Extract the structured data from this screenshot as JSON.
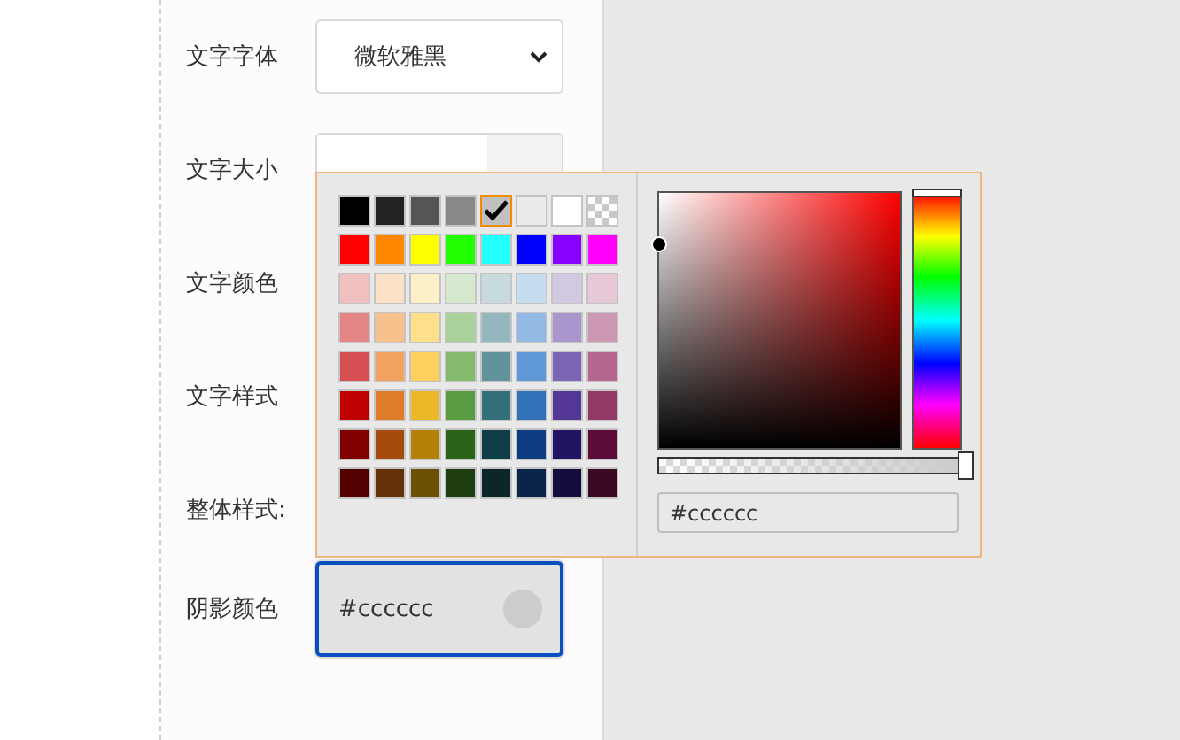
{
  "fields": [
    {
      "kind": "select",
      "label": "文字字体",
      "value": "微软雅黑"
    },
    {
      "kind": "unit",
      "label": "文字大小"
    },
    {
      "kind": "label",
      "label": "文字颜色"
    },
    {
      "kind": "label",
      "label": "文字样式"
    },
    {
      "kind": "label",
      "label": "整体样式:"
    },
    {
      "kind": "color",
      "label": "阴影颜色",
      "value": "#cccccc",
      "color": "#cccccc",
      "focused": true
    }
  ],
  "color_popup": {
    "swatches": [
      {
        "kind": "solid",
        "color": "#000000",
        "selected": false
      },
      {
        "kind": "solid",
        "color": "#222222",
        "selected": false
      },
      {
        "kind": "solid",
        "color": "#555555",
        "selected": false
      },
      {
        "kind": "solid",
        "color": "#888888",
        "selected": false
      },
      {
        "kind": "solid",
        "color": "#c0c0c0",
        "selected": true
      },
      {
        "kind": "solid",
        "color": "#ebebeb",
        "selected": false
      },
      {
        "kind": "solid",
        "color": "#ffffff",
        "selected": false
      },
      {
        "kind": "transparent",
        "selected": false
      },
      {
        "kind": "solid",
        "color": "#ff0000",
        "selected": false
      },
      {
        "kind": "solid",
        "color": "#ff8800",
        "selected": false
      },
      {
        "kind": "solid",
        "color": "#ffff00",
        "selected": false
      },
      {
        "kind": "solid",
        "color": "#22ff00",
        "selected": false
      },
      {
        "kind": "solid",
        "color": "#22ffff",
        "selected": false
      },
      {
        "kind": "solid",
        "color": "#0000ff",
        "selected": false
      },
      {
        "kind": "solid",
        "color": "#8800ff",
        "selected": false
      },
      {
        "kind": "solid",
        "color": "#ff00ff",
        "selected": false
      },
      {
        "kind": "solid",
        "color": "#f0c0c0",
        "selected": false
      },
      {
        "kind": "solid",
        "color": "#fbe2c6",
        "selected": false
      },
      {
        "kind": "solid",
        "color": "#fdf0c8",
        "selected": false
      },
      {
        "kind": "solid",
        "color": "#d5e7cc",
        "selected": false
      },
      {
        "kind": "solid",
        "color": "#c8dade",
        "selected": false
      },
      {
        "kind": "solid",
        "color": "#c6dcef",
        "selected": false
      },
      {
        "kind": "solid",
        "color": "#d1c9e2",
        "selected": false
      },
      {
        "kind": "solid",
        "color": "#e6c8d7",
        "selected": false
      },
      {
        "kind": "solid",
        "color": "#e48585",
        "selected": false
      },
      {
        "kind": "solid",
        "color": "#f7c08c",
        "selected": false
      },
      {
        "kind": "solid",
        "color": "#fedf8a",
        "selected": false
      },
      {
        "kind": "solid",
        "color": "#a9d19a",
        "selected": false
      },
      {
        "kind": "solid",
        "color": "#92b7bd",
        "selected": false
      },
      {
        "kind": "solid",
        "color": "#91b9e4",
        "selected": false
      },
      {
        "kind": "solid",
        "color": "#a996cd",
        "selected": false
      },
      {
        "kind": "solid",
        "color": "#cd98b2",
        "selected": false
      },
      {
        "kind": "solid",
        "color": "#d65053",
        "selected": false
      },
      {
        "kind": "solid",
        "color": "#f2a15f",
        "selected": false
      },
      {
        "kind": "solid",
        "color": "#fdcf5c",
        "selected": false
      },
      {
        "kind": "solid",
        "color": "#84ba6b",
        "selected": false
      },
      {
        "kind": "solid",
        "color": "#61939c",
        "selected": false
      },
      {
        "kind": "solid",
        "color": "#5f98d6",
        "selected": false
      },
      {
        "kind": "solid",
        "color": "#7d65b5",
        "selected": false
      },
      {
        "kind": "solid",
        "color": "#b66790",
        "selected": false
      },
      {
        "kind": "solid",
        "color": "#bf0000",
        "selected": false
      },
      {
        "kind": "solid",
        "color": "#df7c29",
        "selected": false
      },
      {
        "kind": "solid",
        "color": "#ecb82a",
        "selected": false
      },
      {
        "kind": "solid",
        "color": "#5a9a41",
        "selected": false
      },
      {
        "kind": "solid",
        "color": "#346f7a",
        "selected": false
      },
      {
        "kind": "solid",
        "color": "#3071ba",
        "selected": false
      },
      {
        "kind": "solid",
        "color": "#523795",
        "selected": false
      },
      {
        "kind": "solid",
        "color": "#933966",
        "selected": false
      },
      {
        "kind": "solid",
        "color": "#800000",
        "selected": false
      },
      {
        "kind": "solid",
        "color": "#a54b0c",
        "selected": false
      },
      {
        "kind": "solid",
        "color": "#b38107",
        "selected": false
      },
      {
        "kind": "solid",
        "color": "#2a6217",
        "selected": false
      },
      {
        "kind": "solid",
        "color": "#0f3d4a",
        "selected": false
      },
      {
        "kind": "solid",
        "color": "#0d3d80",
        "selected": false
      },
      {
        "kind": "solid",
        "color": "#231363",
        "selected": false
      },
      {
        "kind": "solid",
        "color": "#5c0c39",
        "selected": false
      },
      {
        "kind": "solid",
        "color": "#520000",
        "selected": false
      },
      {
        "kind": "solid",
        "color": "#652f08",
        "selected": false
      },
      {
        "kind": "solid",
        "color": "#6b5003",
        "selected": false
      },
      {
        "kind": "solid",
        "color": "#1e3d10",
        "selected": false
      },
      {
        "kind": "solid",
        "color": "#0e262a",
        "selected": false
      },
      {
        "kind": "solid",
        "color": "#0a2549",
        "selected": false
      },
      {
        "kind": "solid",
        "color": "#140c3a",
        "selected": false
      },
      {
        "kind": "solid",
        "color": "#3a0a25",
        "selected": false
      }
    ],
    "hue": {
      "level": 0
    },
    "alpha": {
      "level": 1
    },
    "hex": "#cccccc"
  }
}
